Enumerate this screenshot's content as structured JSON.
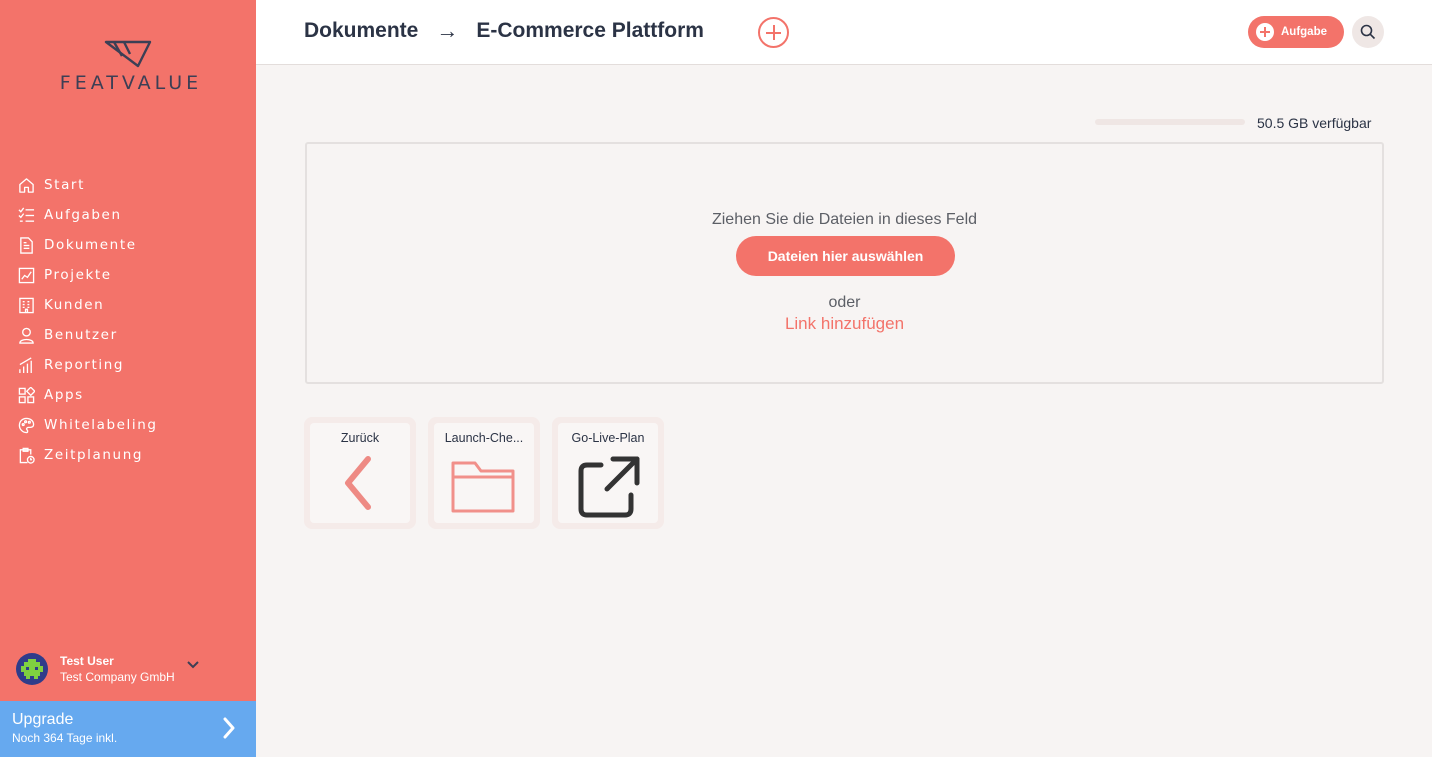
{
  "brand": {
    "logo_text": "FEATVALUE"
  },
  "sidebar": {
    "items": [
      {
        "label": "Start",
        "icon": "home-icon"
      },
      {
        "label": "Aufgaben",
        "icon": "checklist-icon"
      },
      {
        "label": "Dokumente",
        "icon": "document-icon"
      },
      {
        "label": "Projekte",
        "icon": "chart-icon"
      },
      {
        "label": "Kunden",
        "icon": "building-icon"
      },
      {
        "label": "Benutzer",
        "icon": "user-icon"
      },
      {
        "label": "Reporting",
        "icon": "bar-chart-icon"
      },
      {
        "label": "Apps",
        "icon": "apps-icon"
      },
      {
        "label": "Whitelabeling",
        "icon": "palette-icon"
      },
      {
        "label": "Zeitplanung",
        "icon": "clipboard-clock-icon"
      }
    ],
    "user": {
      "name": "Test User",
      "company": "Test Company GmbH"
    },
    "upgrade": {
      "title": "Upgrade",
      "subtitle": "Noch 364 Tage inkl."
    }
  },
  "header": {
    "crumb_1": "Dokumente",
    "arrow": "→",
    "crumb_2": "E-Commerce Plattform",
    "task_button": "Aufgabe"
  },
  "storage": {
    "text": "50.5 GB verfügbar",
    "used_fraction": 0.0
  },
  "dropzone": {
    "instruction": "Ziehen Sie die Dateien in dieses Feld",
    "select_button": "Dateien hier auswählen",
    "or": "oder",
    "add_link": "Link hinzufügen"
  },
  "tiles": [
    {
      "label": "Zurück",
      "icon": "chevron-left-icon"
    },
    {
      "label": "Launch-Che...",
      "icon": "folder-icon"
    },
    {
      "label": "Go-Live-Plan",
      "icon": "external-link-icon"
    }
  ],
  "colors": {
    "primary": "#f3736a",
    "upgrade": "#66a9ef",
    "logo": "#3c3f55",
    "text": "#2b3345"
  }
}
